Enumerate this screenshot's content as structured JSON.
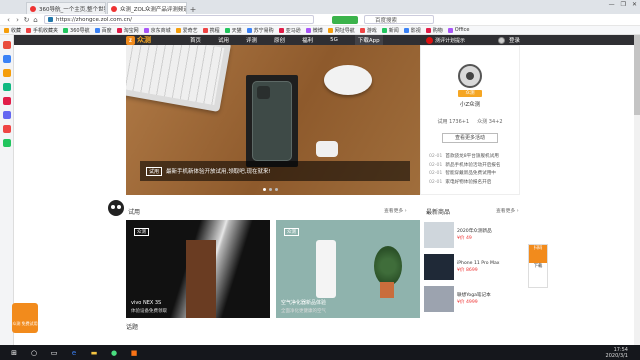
{
  "browser": {
    "tabs": [
      {
        "label": "360导航_一个主页,整个世界",
        "active": false
      },
      {
        "label": "众测_ZOL众测产品评测频道",
        "active": true
      },
      {
        "label": "",
        "active": false
      }
    ],
    "new_tab": "+",
    "url": "https://zhongce.zol.com.cn/",
    "search_placeholder": "百度搜索",
    "green_btn": "",
    "window_buttons": [
      "—",
      "❐",
      "✕"
    ]
  },
  "bookmarks": [
    "收藏",
    "手机收藏夹",
    "360导航",
    "百度",
    "淘宝网",
    "京东商城",
    "爱奇艺",
    "携程",
    "天猫",
    "苏宁易购",
    "亚马逊",
    "微博",
    "网址导航",
    "游戏",
    "新闻",
    "影视",
    "购物",
    "Office"
  ],
  "sitenav": {
    "logo_text": "众测",
    "links": [
      "首页",
      "试用",
      "评测",
      "原创",
      "福利",
      "5G",
      "下载App"
    ],
    "promo": "测评计划提示",
    "login": "登录"
  },
  "hero": {
    "caption_tag": "试用",
    "caption": "最新手机新体验开放试用,领取吧,现在就来!",
    "dots": 3
  },
  "userpanel": {
    "badge": "众测",
    "name": "小Z众测",
    "stats": [
      "试用 1736+1",
      "众测 34+2"
    ],
    "button": "查看更多活动",
    "list": [
      {
        "d": "02-01",
        "t": "首款骁龙8平台旗舰机试用"
      },
      {
        "d": "02-01",
        "t": "新品手机体验活动开启报名"
      },
      {
        "d": "02-01",
        "t": "智能穿戴新品免费试用中"
      },
      {
        "d": "02-01",
        "t": "家电好物体验报名开启"
      }
    ]
  },
  "trial": {
    "title": "试用",
    "more": "查看更多 ›",
    "cards": [
      {
        "tag": "众测",
        "label": "vivo NEX 3S",
        "sub": "体验设备免费领取"
      },
      {
        "tag": "众测",
        "label": "空气净化器新品体验",
        "sub": "全面净化更健康的空气"
      }
    ]
  },
  "latest": {
    "title": "最新商品",
    "more": "查看更多 ›",
    "items": [
      {
        "name": "2020年众测新品",
        "price": "¥价 49"
      },
      {
        "name": "iPhone 11 Pro Max",
        "price": "¥价 8699"
      },
      {
        "name": "联想Yoga笔记本",
        "price": "¥价 4999"
      }
    ]
  },
  "next_section": "话题",
  "float_button": "众测\n免费试用",
  "side_ad": [
    "扫码",
    "下载"
  ],
  "taskbar": {
    "time": "17:54",
    "date": "2020/3/1"
  }
}
